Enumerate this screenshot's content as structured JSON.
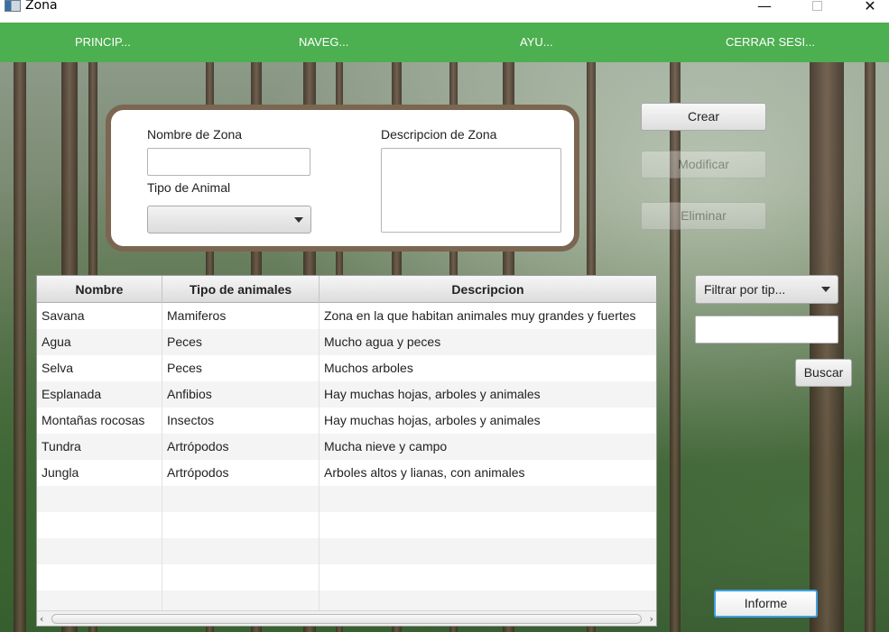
{
  "window": {
    "title": "Zona"
  },
  "menu": {
    "items": [
      "PRINCIP...",
      "NAVEG...",
      "AYU...",
      "CERRAR SESI..."
    ]
  },
  "form": {
    "zone_name_label": "Nombre de Zona",
    "zone_name_value": "",
    "animal_type_label": "Tipo de Animal",
    "animal_type_selected": "",
    "description_label": "Descripcion de Zona",
    "description_value": ""
  },
  "actions": {
    "create": "Crear",
    "modify": "Modificar",
    "delete": "Eliminar"
  },
  "filter": {
    "combo_text": "Filtrar por tip...",
    "search_value": "",
    "search_button": "Buscar"
  },
  "report_button": "Informe",
  "table": {
    "columns": [
      "Nombre",
      "Tipo de animales",
      "Descripcion"
    ],
    "rows": [
      [
        "Savana",
        "Mamiferos",
        "Zona en la que habitan animales muy grandes y fuertes"
      ],
      [
        "Agua",
        "Peces",
        "Mucho agua y peces"
      ],
      [
        "Selva",
        "Peces",
        "Muchos arboles"
      ],
      [
        "Esplanada",
        "Anfibios",
        "Hay muchas hojas, arboles y animales"
      ],
      [
        "Montañas rocosas",
        "Insectos",
        "Hay muchas hojas, arboles y animales"
      ],
      [
        "Tundra",
        "Artrópodos",
        "Mucha nieve y campo"
      ],
      [
        "Jungla",
        "Artrópodos",
        "Arboles altos y lianas, con animales"
      ]
    ]
  },
  "colors": {
    "menu_bar": "#4caf50",
    "panel_border": "#7a6651",
    "focus": "#3ca1e0"
  }
}
